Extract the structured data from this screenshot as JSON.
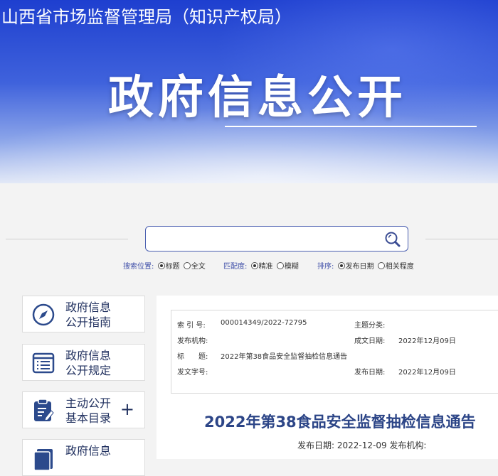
{
  "header": {
    "org_name": "山西省市场监督管理局（知识产权局）",
    "section_title": "政府信息公开"
  },
  "search": {
    "value": "",
    "placeholder": "",
    "position_label": "搜索位置:",
    "position_options": [
      "标题",
      "全文"
    ],
    "match_label": "匹配度:",
    "match_options": [
      "精准",
      "模糊"
    ],
    "sort_label": "排序:",
    "sort_options": [
      "发布日期",
      "相关程度"
    ]
  },
  "sidebar": {
    "items": [
      {
        "line1": "政府信息",
        "line2": "公开指南",
        "icon": "compass-icon"
      },
      {
        "line1": "政府信息",
        "line2": "公开规定",
        "icon": "list-document-icon"
      },
      {
        "line1": "主动公开",
        "line2": "基本目录",
        "icon": "clipboard-icon",
        "expand": "+"
      },
      {
        "line1": "政府信息",
        "line2": "",
        "icon": "document-icon"
      }
    ]
  },
  "meta": {
    "index_label": "索 引 号:",
    "index_value": "000014349/2022-72795",
    "topic_label": "主题分类:",
    "topic_value": "",
    "publisher_label": "发布机构:",
    "publisher_value": "",
    "created_label": "成文日期:",
    "created_value": "2022年12月09日",
    "title_label": "标　　题:",
    "title_value": "2022年第38食品安全监督抽检信息通告",
    "docno_label": "发文字号:",
    "docno_value": "",
    "published_label": "发布日期:",
    "published_value": "2022年12月09日"
  },
  "article": {
    "title": "2022年第38食品安全监督抽检信息通告",
    "subline": "发布日期: 2022-12-09 发布机构:"
  },
  "colors": {
    "banner_blue": "#1e3fcf",
    "accent_navy": "#2c4587",
    "link_blue": "#3f4fa8"
  }
}
